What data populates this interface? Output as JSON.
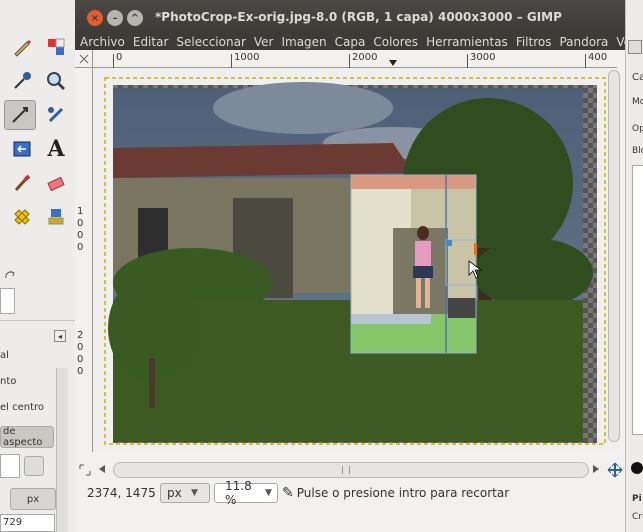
{
  "window": {
    "title": "*PhotoCrop-Ex-orig.jpg-8.0 (RGB, 1 capa) 4000x3000 – GIMP",
    "controls": {
      "close": "×",
      "minimize": "–",
      "maximize": "^"
    }
  },
  "menu": [
    "Archivo",
    "Editar",
    "Seleccionar",
    "Ver",
    "Imagen",
    "Capa",
    "Colores",
    "Herramientas",
    "Filtros",
    "Pandora",
    "Venta"
  ],
  "rulers": {
    "horizontal": [
      "0",
      "1000",
      "2000",
      "3000",
      "400"
    ],
    "vertical_digits": [
      "1",
      "0",
      "0",
      "0",
      "2",
      "0",
      "0",
      "0"
    ]
  },
  "status": {
    "coords": "2374, 1475",
    "unit": "px",
    "zoom": "11.8 %",
    "message": "Pulse o presione intro para recortar"
  },
  "tool_options": {
    "line1": "al",
    "line2": "nto",
    "line3": "el centro",
    "aspect_button": "de aspecto",
    "unit_button": "px",
    "value": "729"
  },
  "right_panel": {
    "labels": [
      "Ca",
      "Mo",
      "Op",
      "Blo",
      "Pi",
      "Cri"
    ]
  },
  "image": {
    "sky": "#5e6f86",
    "foliage": "#3f5a2a",
    "crop_highlight": "#8dd06a"
  }
}
